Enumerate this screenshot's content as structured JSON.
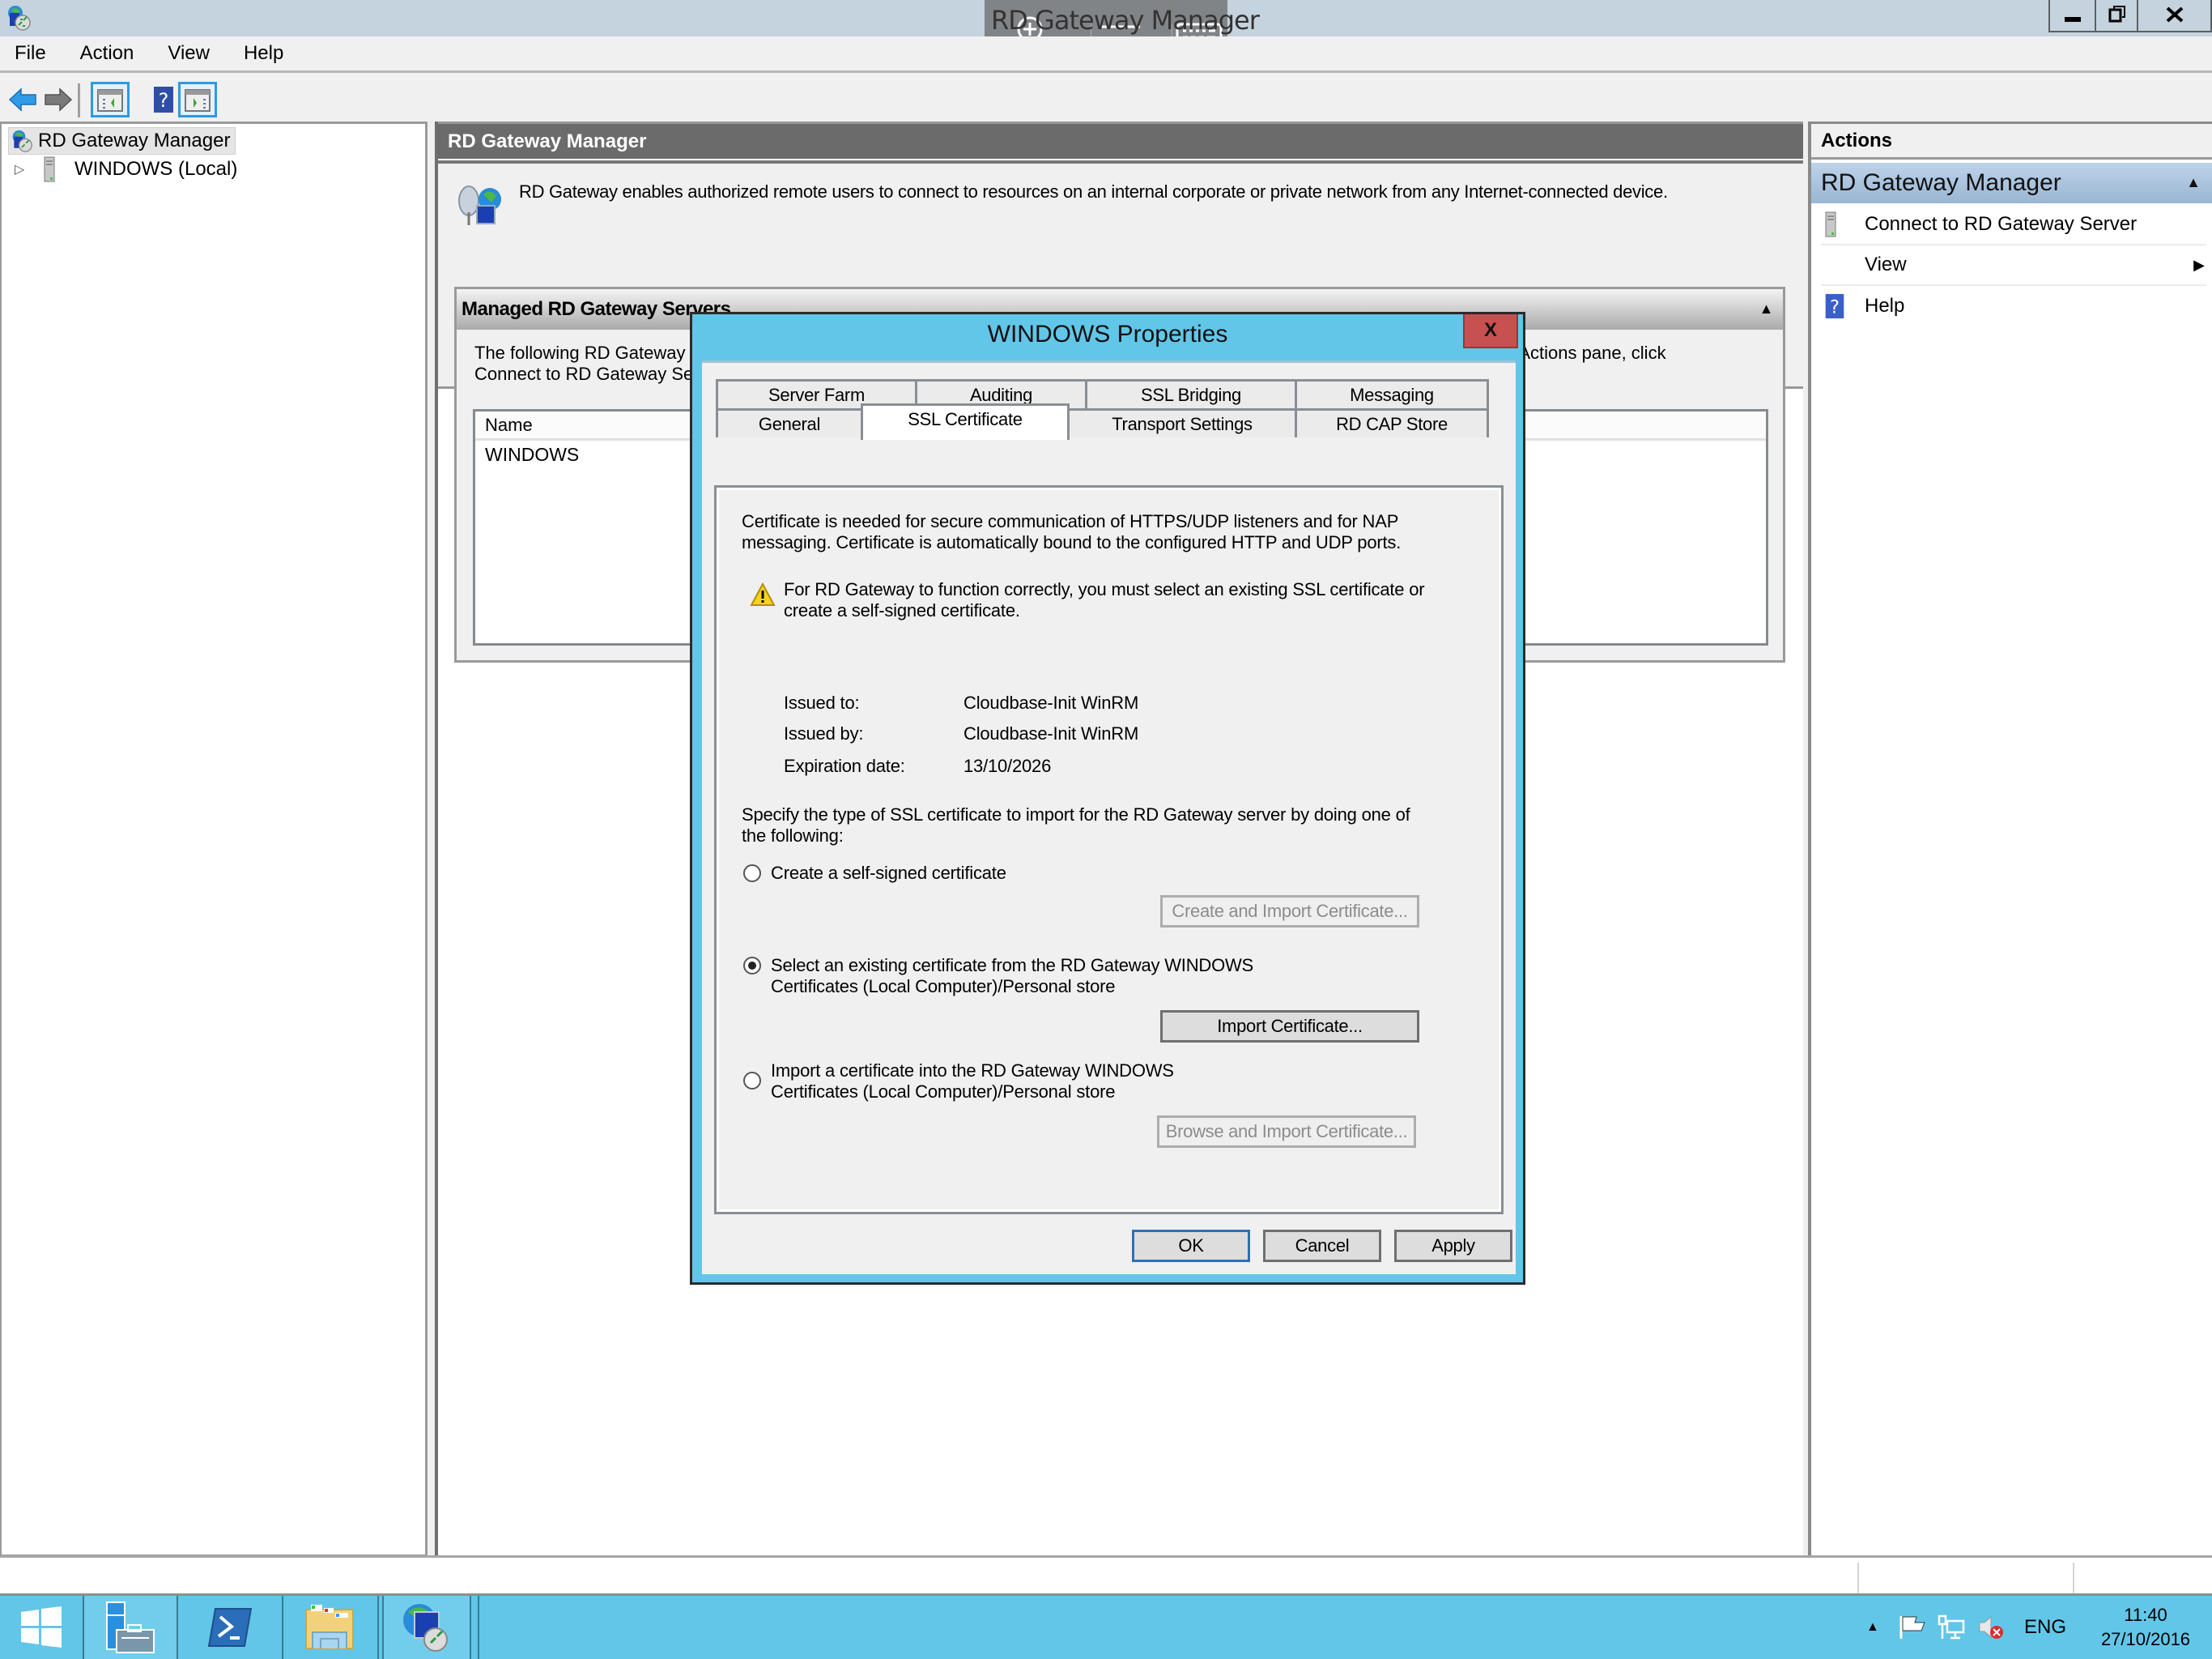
{
  "window": {
    "title": "RD Gateway Manager",
    "controls": {
      "minimize": "minimize",
      "restore": "restore",
      "close": "close"
    }
  },
  "rdp_overlay": {
    "icons": [
      "zoom-in-icon",
      "menu-icon",
      "keyboard-icon"
    ]
  },
  "menu": [
    "File",
    "Action",
    "View",
    "Help"
  ],
  "toolbar": [
    "back",
    "forward",
    "show-hide-console-tree",
    "help",
    "show-hide-action-pane"
  ],
  "tree": {
    "root": "RD Gateway Manager",
    "children": [
      "WINDOWS (Local)"
    ]
  },
  "center": {
    "header": "RD Gateway Manager",
    "description": "RD Gateway enables authorized remote users to connect to resources on an internal corporate or private network from any Internet-connected device.",
    "managed": {
      "title": "Managed RD Gateway Servers",
      "desc_line1_left": "The following RD Gateway s",
      "desc_line1_right": "he Actions pane, click",
      "desc_line2_left": "Connect to RD Gateway Ser",
      "list_header": "Name",
      "rows": [
        "WINDOWS"
      ]
    }
  },
  "actions": {
    "title": "Actions",
    "group": "RD Gateway Manager",
    "items": [
      "Connect to RD Gateway Server",
      "View",
      "Help"
    ]
  },
  "taskbar": {
    "apps": [
      "Start",
      "Server Manager",
      "Windows PowerShell",
      "File Explorer",
      "RD Gateway Manager"
    ],
    "tray": {
      "language": "ENG",
      "time": "11:40",
      "date": "27/10/2016"
    }
  },
  "dialog": {
    "title": "WINDOWS Properties",
    "close_label": "X",
    "tabs_row1": [
      "Server Farm",
      "Auditing",
      "SSL Bridging",
      "Messaging"
    ],
    "tabs_row2": [
      "General",
      "SSL Certificate",
      "Transport Settings",
      "RD CAP Store"
    ],
    "active_tab": "SSL Certificate",
    "intro_line1": "Certificate is needed for secure communication of HTTPS/UDP listeners and for NAP",
    "intro_line2": "messaging. Certificate is automatically bound to the configured HTTP and UDP ports.",
    "warning_line1": "For RD Gateway to function correctly, you must select an existing SSL certificate or",
    "warning_line2": "create a self-signed certificate.",
    "cert": {
      "issued_to_label": "Issued to:",
      "issued_to": "Cloudbase-Init WinRM",
      "issued_by_label": "Issued by:",
      "issued_by": "Cloudbase-Init WinRM",
      "expiration_label": "Expiration date:",
      "expiration": "13/10/2026"
    },
    "specify_line1": "Specify the type of SSL certificate to import for the RD Gateway server by doing one of",
    "specify_line2": "the following:",
    "options": [
      {
        "label1": "Create a self-signed certificate",
        "label2": "",
        "checked": false,
        "button": "Create and Import Certificate...",
        "button_enabled": false
      },
      {
        "label1": "Select an existing certificate from the RD Gateway WINDOWS",
        "label2": "Certificates (Local Computer)/Personal store",
        "checked": true,
        "button": "Import Certificate...",
        "button_enabled": true
      },
      {
        "label1": "Import a certificate into the RD Gateway WINDOWS",
        "label2": "Certificates (Local Computer)/Personal store",
        "checked": false,
        "button": "Browse and Import Certificate...",
        "button_enabled": false
      }
    ],
    "buttons": {
      "ok": "OK",
      "cancel": "Cancel",
      "apply": "Apply"
    }
  },
  "colors": {
    "dialog_frame": "#62c6e8",
    "taskbar": "#62c6e8",
    "close_button": "#c75050",
    "actions_group": "#a9c4df"
  }
}
